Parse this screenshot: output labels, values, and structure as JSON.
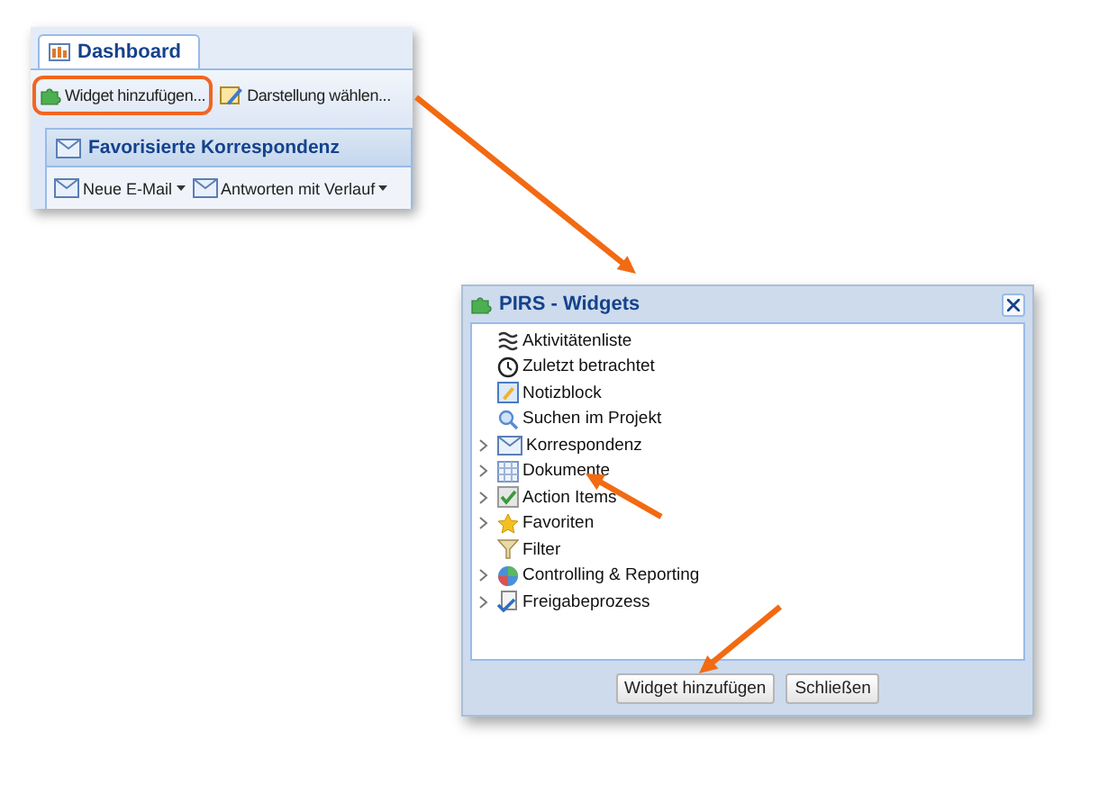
{
  "dashboard": {
    "tab": {
      "label": "Dashboard",
      "selected": true
    },
    "toolbar": [
      {
        "label": "Widget hinzufügen...",
        "highlighted": true
      },
      {
        "label": "Darstellung wählen...",
        "highlighted": false
      }
    ],
    "panel": {
      "title": "Favorisierte Korrespondenz",
      "buttons": [
        {
          "label": "Neue E-Mail"
        },
        {
          "label": "Antworten mit Verlauf"
        }
      ]
    }
  },
  "dialog": {
    "title": "PIRS - Widgets",
    "items": [
      {
        "label": "Aktivitätenliste",
        "kind": "leaf"
      },
      {
        "label": "Zuletzt betrachtet",
        "kind": "leaf"
      },
      {
        "label": "Notizblock",
        "kind": "leaf"
      },
      {
        "label": "Suchen im Projekt",
        "kind": "leaf"
      },
      {
        "label": "Korrespondenz",
        "kind": "group"
      },
      {
        "label": "Dokumente",
        "kind": "group"
      },
      {
        "label": "Action Items",
        "kind": "group"
      },
      {
        "label": "Favoriten",
        "kind": "group"
      },
      {
        "label": "Filter",
        "kind": "leaf"
      },
      {
        "label": "Controlling & Reporting",
        "kind": "group"
      },
      {
        "label": "Freigabeprozess",
        "kind": "group"
      }
    ],
    "buttons": [
      "Widget hinzufügen",
      "Schließen"
    ]
  }
}
